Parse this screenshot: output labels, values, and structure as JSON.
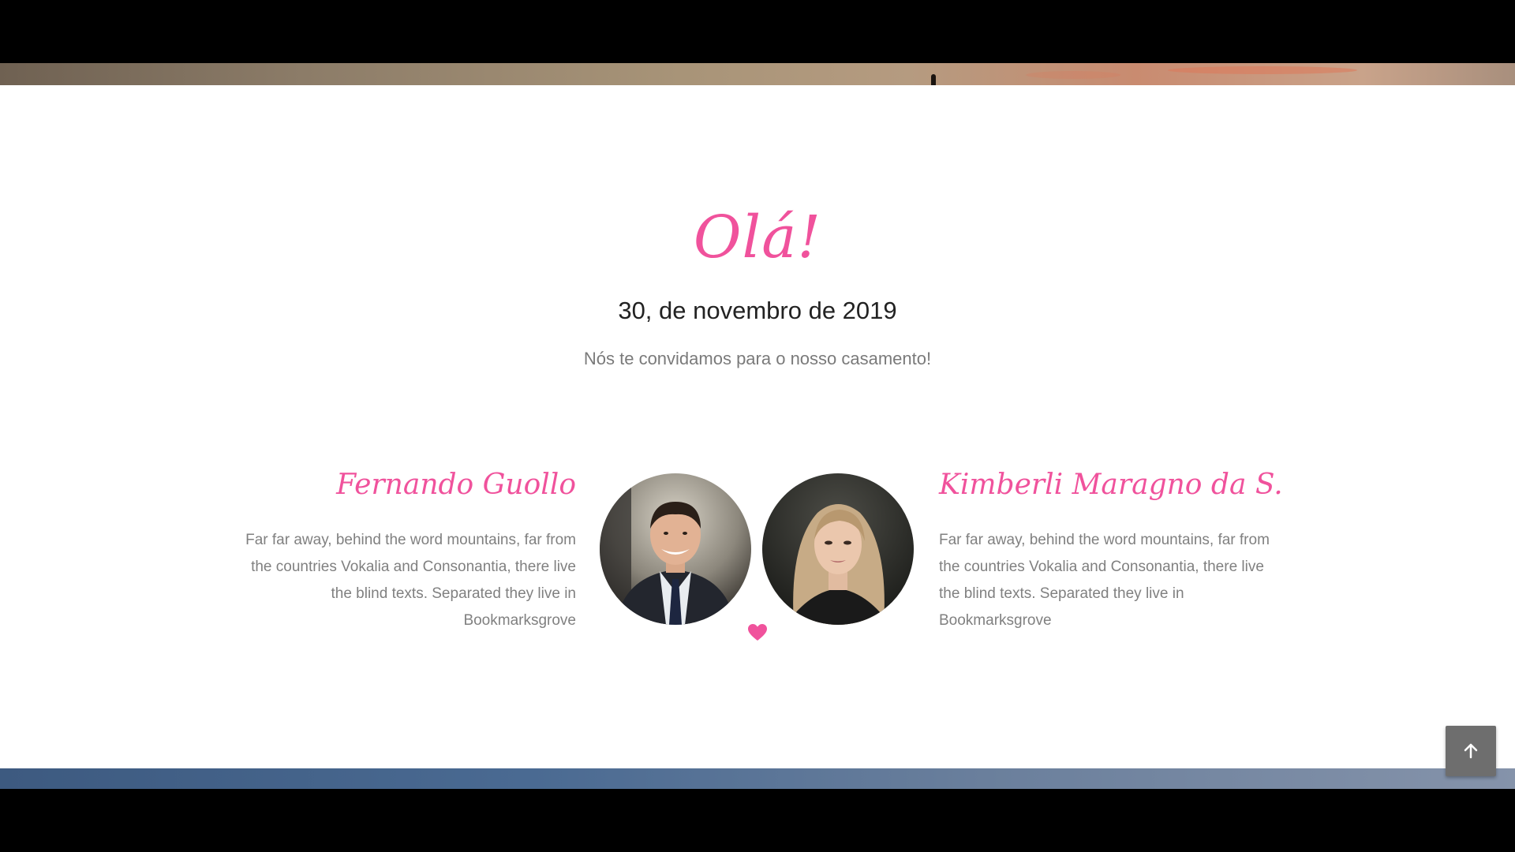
{
  "greeting": "Olá!",
  "date": "30, de novembro de 2019",
  "invitation": "Nós te convidamos para o nosso casamento!",
  "groom": {
    "name": "Fernando Guollo",
    "bio": "Far far away, behind the word mountains, far from the countries Vokalia and Consonantia, there live the blind texts. Separated they live in Bookmarksgrove"
  },
  "bride": {
    "name": "Kimberli Maragno da S.",
    "bio": "Far far away, behind the word mountains, far from the countries Vokalia and Consonantia, there live the blind texts. Separated they live in Bookmarksgrove"
  },
  "icons": {
    "heart": "heart-icon",
    "scroll_top": "arrow-up-icon"
  },
  "colors": {
    "accent": "#f0529c",
    "text_dark": "#222222",
    "text_muted": "#808080",
    "background": "#ffffff"
  }
}
